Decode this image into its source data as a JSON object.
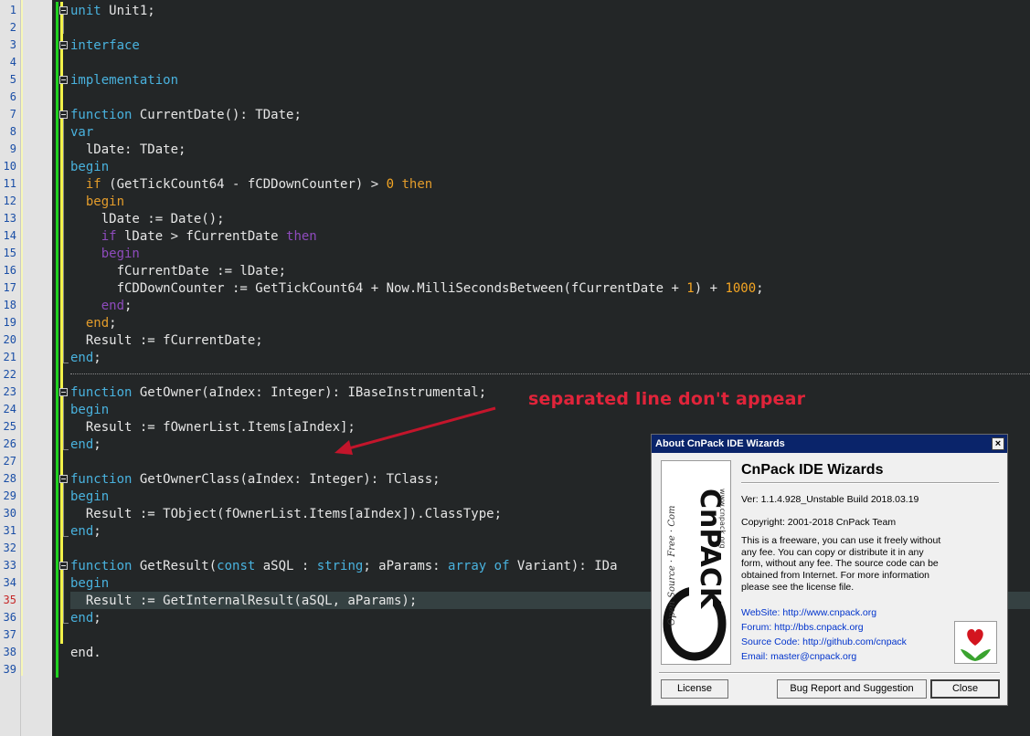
{
  "editor": {
    "line_numbers": [
      "1",
      "2",
      "3",
      "4",
      "5",
      "6",
      "7",
      "8",
      "9",
      "10",
      "11",
      "12",
      "13",
      "14",
      "15",
      "16",
      "17",
      "18",
      "19",
      "20",
      "21",
      "22",
      "23",
      "24",
      "25",
      "26",
      "27",
      "28",
      "29",
      "30",
      "31",
      "32",
      "33",
      "34",
      "35",
      "36",
      "37",
      "38",
      "39"
    ],
    "current_line": "35",
    "code": {
      "l1": {
        "a": "unit",
        "b": " Unit1;"
      },
      "l3": {
        "a": "interface"
      },
      "l5": {
        "a": "implementation"
      },
      "l7": {
        "a": "function",
        "b": " CurrentDate(): TDate;"
      },
      "l8": {
        "a": "var"
      },
      "l9": {
        "b": "  lDate: TDate;"
      },
      "l10": {
        "a": "begin"
      },
      "l11": {
        "pre": "  ",
        "a": "if",
        "b": " (GetTickCount64 - fCDDownCounter) > ",
        "n": "0",
        "sp": " ",
        "c": "then"
      },
      "l12": {
        "pre": "  ",
        "a": "begin"
      },
      "l13": {
        "b": "    lDate := Date();"
      },
      "l14": {
        "pre": "    ",
        "a": "if",
        "b": " lDate > fCurrentDate ",
        "c": "then"
      },
      "l15": {
        "pre": "    ",
        "a": "begin"
      },
      "l16": {
        "b": "      fCurrentDate := lDate;"
      },
      "l17": {
        "b": "      fCDDownCounter := GetTickCount64 + Now.MilliSecondsBetween(fCurrentDate + ",
        "n": "1",
        "b2": ") + ",
        "n2": "1000",
        "e": ";"
      },
      "l18": {
        "pre": "    ",
        "a": "end",
        "b": ";"
      },
      "l19": {
        "pre": "  ",
        "a": "end",
        "b": ";"
      },
      "l20": {
        "b": "  Result := fCurrentDate;"
      },
      "l21": {
        "a": "end",
        "b": ";"
      },
      "l23": {
        "a": "function",
        "b": " GetOwner(aIndex: Integer): IBaseInstrumental;"
      },
      "l24": {
        "a": "begin"
      },
      "l25": {
        "b": "  Result := fOwnerList.Items[aIndex];"
      },
      "l26": {
        "a": "end",
        "b": ";"
      },
      "l28": {
        "a": "function",
        "b": " GetOwnerClass(aIndex: Integer): TClass;"
      },
      "l29": {
        "a": "begin"
      },
      "l30": {
        "b": "  Result := TObject(fOwnerList.Items[aIndex]).ClassType;"
      },
      "l31": {
        "a": "end",
        "b": ";"
      },
      "l33": {
        "a": "function",
        "b": " GetResult(",
        "c": "const",
        "d": " aSQL : ",
        "e": "string",
        "f": "; aParams: ",
        "g": "array",
        "h": " ",
        "i": "of",
        "j": " Variant): IDa"
      },
      "l34": {
        "a": "begin"
      },
      "l35": {
        "b": "  Result := GetInternalResult(aSQL, aParams);"
      },
      "l36": {
        "a": "end",
        "b": ";"
      },
      "l38": {
        "b": "end."
      }
    }
  },
  "annotation": "separated line don't appear",
  "dialog": {
    "title": "About CnPack IDE Wizards",
    "close_glyph": "×",
    "product": "CnPack IDE Wizards",
    "version": "Ver: 1.1.4.928_Unstable Build 2018.03.19",
    "copyright": "Copyright: 2001-2018 CnPack Team",
    "description": "This is a freeware, you can use it freely without any fee. You can copy or distribute it in any form, without any fee. The source code can be obtained from Internet. For more information please see the license file.",
    "website": "WebSite: http://www.cnpack.org",
    "forum": "Forum: http://bbs.cnpack.org",
    "source": "Source Code: http://github.com/cnpack",
    "email": "Email: master@cnpack.org",
    "logo_text": "CnPACK",
    "logo_side": "Open Source · Free · Com",
    "logo_url": "www.cnpack.org",
    "buttons": {
      "license": "License",
      "bug": "Bug Report and Suggestion",
      "close": "Close"
    }
  },
  "colors": {
    "keyword": "#49b2de",
    "number": "#f5a623",
    "then": "#e39c2b",
    "nested": "#8e4bbd",
    "background": "#232627"
  }
}
